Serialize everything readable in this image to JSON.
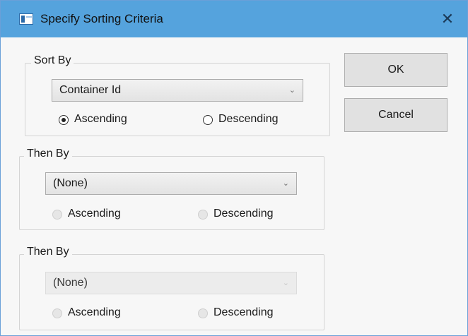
{
  "window": {
    "title": "Specify Sorting Criteria",
    "close_symbol": "✕",
    "icon": "dialog-window-icon"
  },
  "groups": [
    {
      "label": "Sort By",
      "combo_value": "Container Id",
      "enabled": true,
      "ascending": "Ascending",
      "descending": "Descending",
      "selected": "ascending"
    },
    {
      "label": "Then By",
      "combo_value": "(None)",
      "enabled": true,
      "ascending": "Ascending",
      "descending": "Descending",
      "selected": null
    },
    {
      "label": "Then By",
      "combo_value": "(None)",
      "enabled": false,
      "ascending": "Ascending",
      "descending": "Descending",
      "selected": null
    }
  ],
  "buttons": {
    "ok": "OK",
    "cancel": "Cancel"
  },
  "colors": {
    "titlebar": "#55a3dd",
    "client": "#f7f7f7",
    "button": "#e1e1e1"
  }
}
